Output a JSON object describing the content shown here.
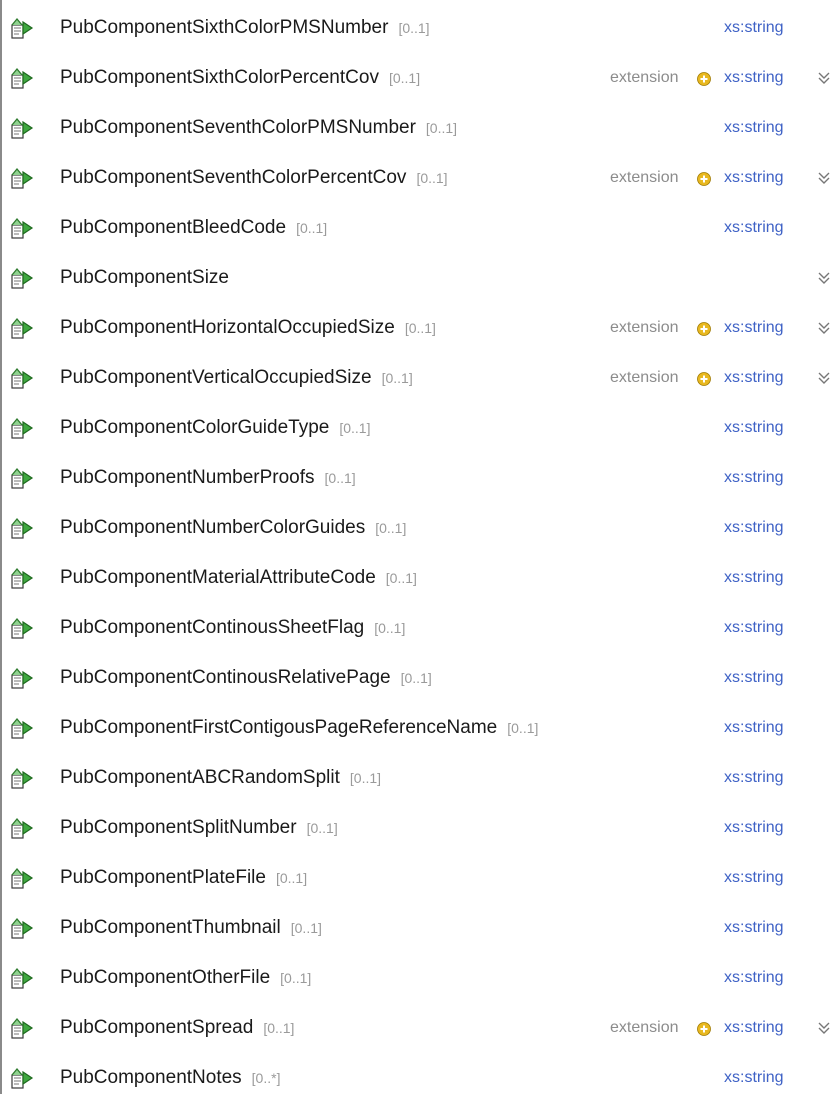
{
  "rows": [
    {
      "name": "PubComponentSixthColorPMSNumber",
      "cardinality": "[0..1]",
      "extension": "",
      "type": "xs:string",
      "expandable": false
    },
    {
      "name": "PubComponentSixthColorPercentCov",
      "cardinality": "[0..1]",
      "extension": "extension",
      "type": "xs:string",
      "expandable": true
    },
    {
      "name": "PubComponentSeventhColorPMSNumber",
      "cardinality": "[0..1]",
      "extension": "",
      "type": "xs:string",
      "expandable": false
    },
    {
      "name": "PubComponentSeventhColorPercentCov",
      "cardinality": "[0..1]",
      "extension": "extension",
      "type": "xs:string",
      "expandable": true
    },
    {
      "name": "PubComponentBleedCode",
      "cardinality": "[0..1]",
      "extension": "",
      "type": "xs:string",
      "expandable": false
    },
    {
      "name": "PubComponentSize",
      "cardinality": "",
      "extension": "",
      "type": "",
      "expandable": true
    },
    {
      "name": "PubComponentHorizontalOccupiedSize",
      "cardinality": "[0..1]",
      "extension": "extension",
      "type": "xs:string",
      "expandable": true
    },
    {
      "name": "PubComponentVerticalOccupiedSize",
      "cardinality": "[0..1]",
      "extension": "extension",
      "type": "xs:string",
      "expandable": true
    },
    {
      "name": "PubComponentColorGuideType",
      "cardinality": "[0..1]",
      "extension": "",
      "type": "xs:string",
      "expandable": false
    },
    {
      "name": "PubComponentNumberProofs",
      "cardinality": "[0..1]",
      "extension": "",
      "type": "xs:string",
      "expandable": false
    },
    {
      "name": "PubComponentNumberColorGuides",
      "cardinality": "[0..1]",
      "extension": "",
      "type": "xs:string",
      "expandable": false
    },
    {
      "name": "PubComponentMaterialAttributeCode",
      "cardinality": "[0..1]",
      "extension": "",
      "type": "xs:string",
      "expandable": false
    },
    {
      "name": "PubComponentContinousSheetFlag",
      "cardinality": "[0..1]",
      "extension": "",
      "type": "xs:string",
      "expandable": false
    },
    {
      "name": "PubComponentContinousRelativePage",
      "cardinality": "[0..1]",
      "extension": "",
      "type": "xs:string",
      "expandable": false
    },
    {
      "name": "PubComponentFirstContigousPageReferenceName",
      "cardinality": "[0..1]",
      "extension": "",
      "type": "xs:string",
      "expandable": false
    },
    {
      "name": "PubComponentABCRandomSplit",
      "cardinality": "[0..1]",
      "extension": "",
      "type": "xs:string",
      "expandable": false
    },
    {
      "name": "PubComponentSplitNumber",
      "cardinality": "[0..1]",
      "extension": "",
      "type": "xs:string",
      "expandable": false
    },
    {
      "name": "PubComponentPlateFile",
      "cardinality": "[0..1]",
      "extension": "",
      "type": "xs:string",
      "expandable": false
    },
    {
      "name": "PubComponentThumbnail",
      "cardinality": "[0..1]",
      "extension": "",
      "type": "xs:string",
      "expandable": false
    },
    {
      "name": "PubComponentOtherFile",
      "cardinality": "[0..1]",
      "extension": "",
      "type": "xs:string",
      "expandable": false
    },
    {
      "name": "PubComponentSpread",
      "cardinality": "[0..1]",
      "extension": "extension",
      "type": "xs:string",
      "expandable": true
    },
    {
      "name": "PubComponentNotes",
      "cardinality": "[0..*]",
      "extension": "",
      "type": "xs:string",
      "expandable": false
    }
  ],
  "icons": {
    "element": "element-icon",
    "extension": "plus-icon",
    "expand": "double-chevron-down-icon"
  },
  "colors": {
    "type_link": "#3f62c6",
    "element_green": "#2e8b2e",
    "extension_plus": "#e0b020"
  }
}
